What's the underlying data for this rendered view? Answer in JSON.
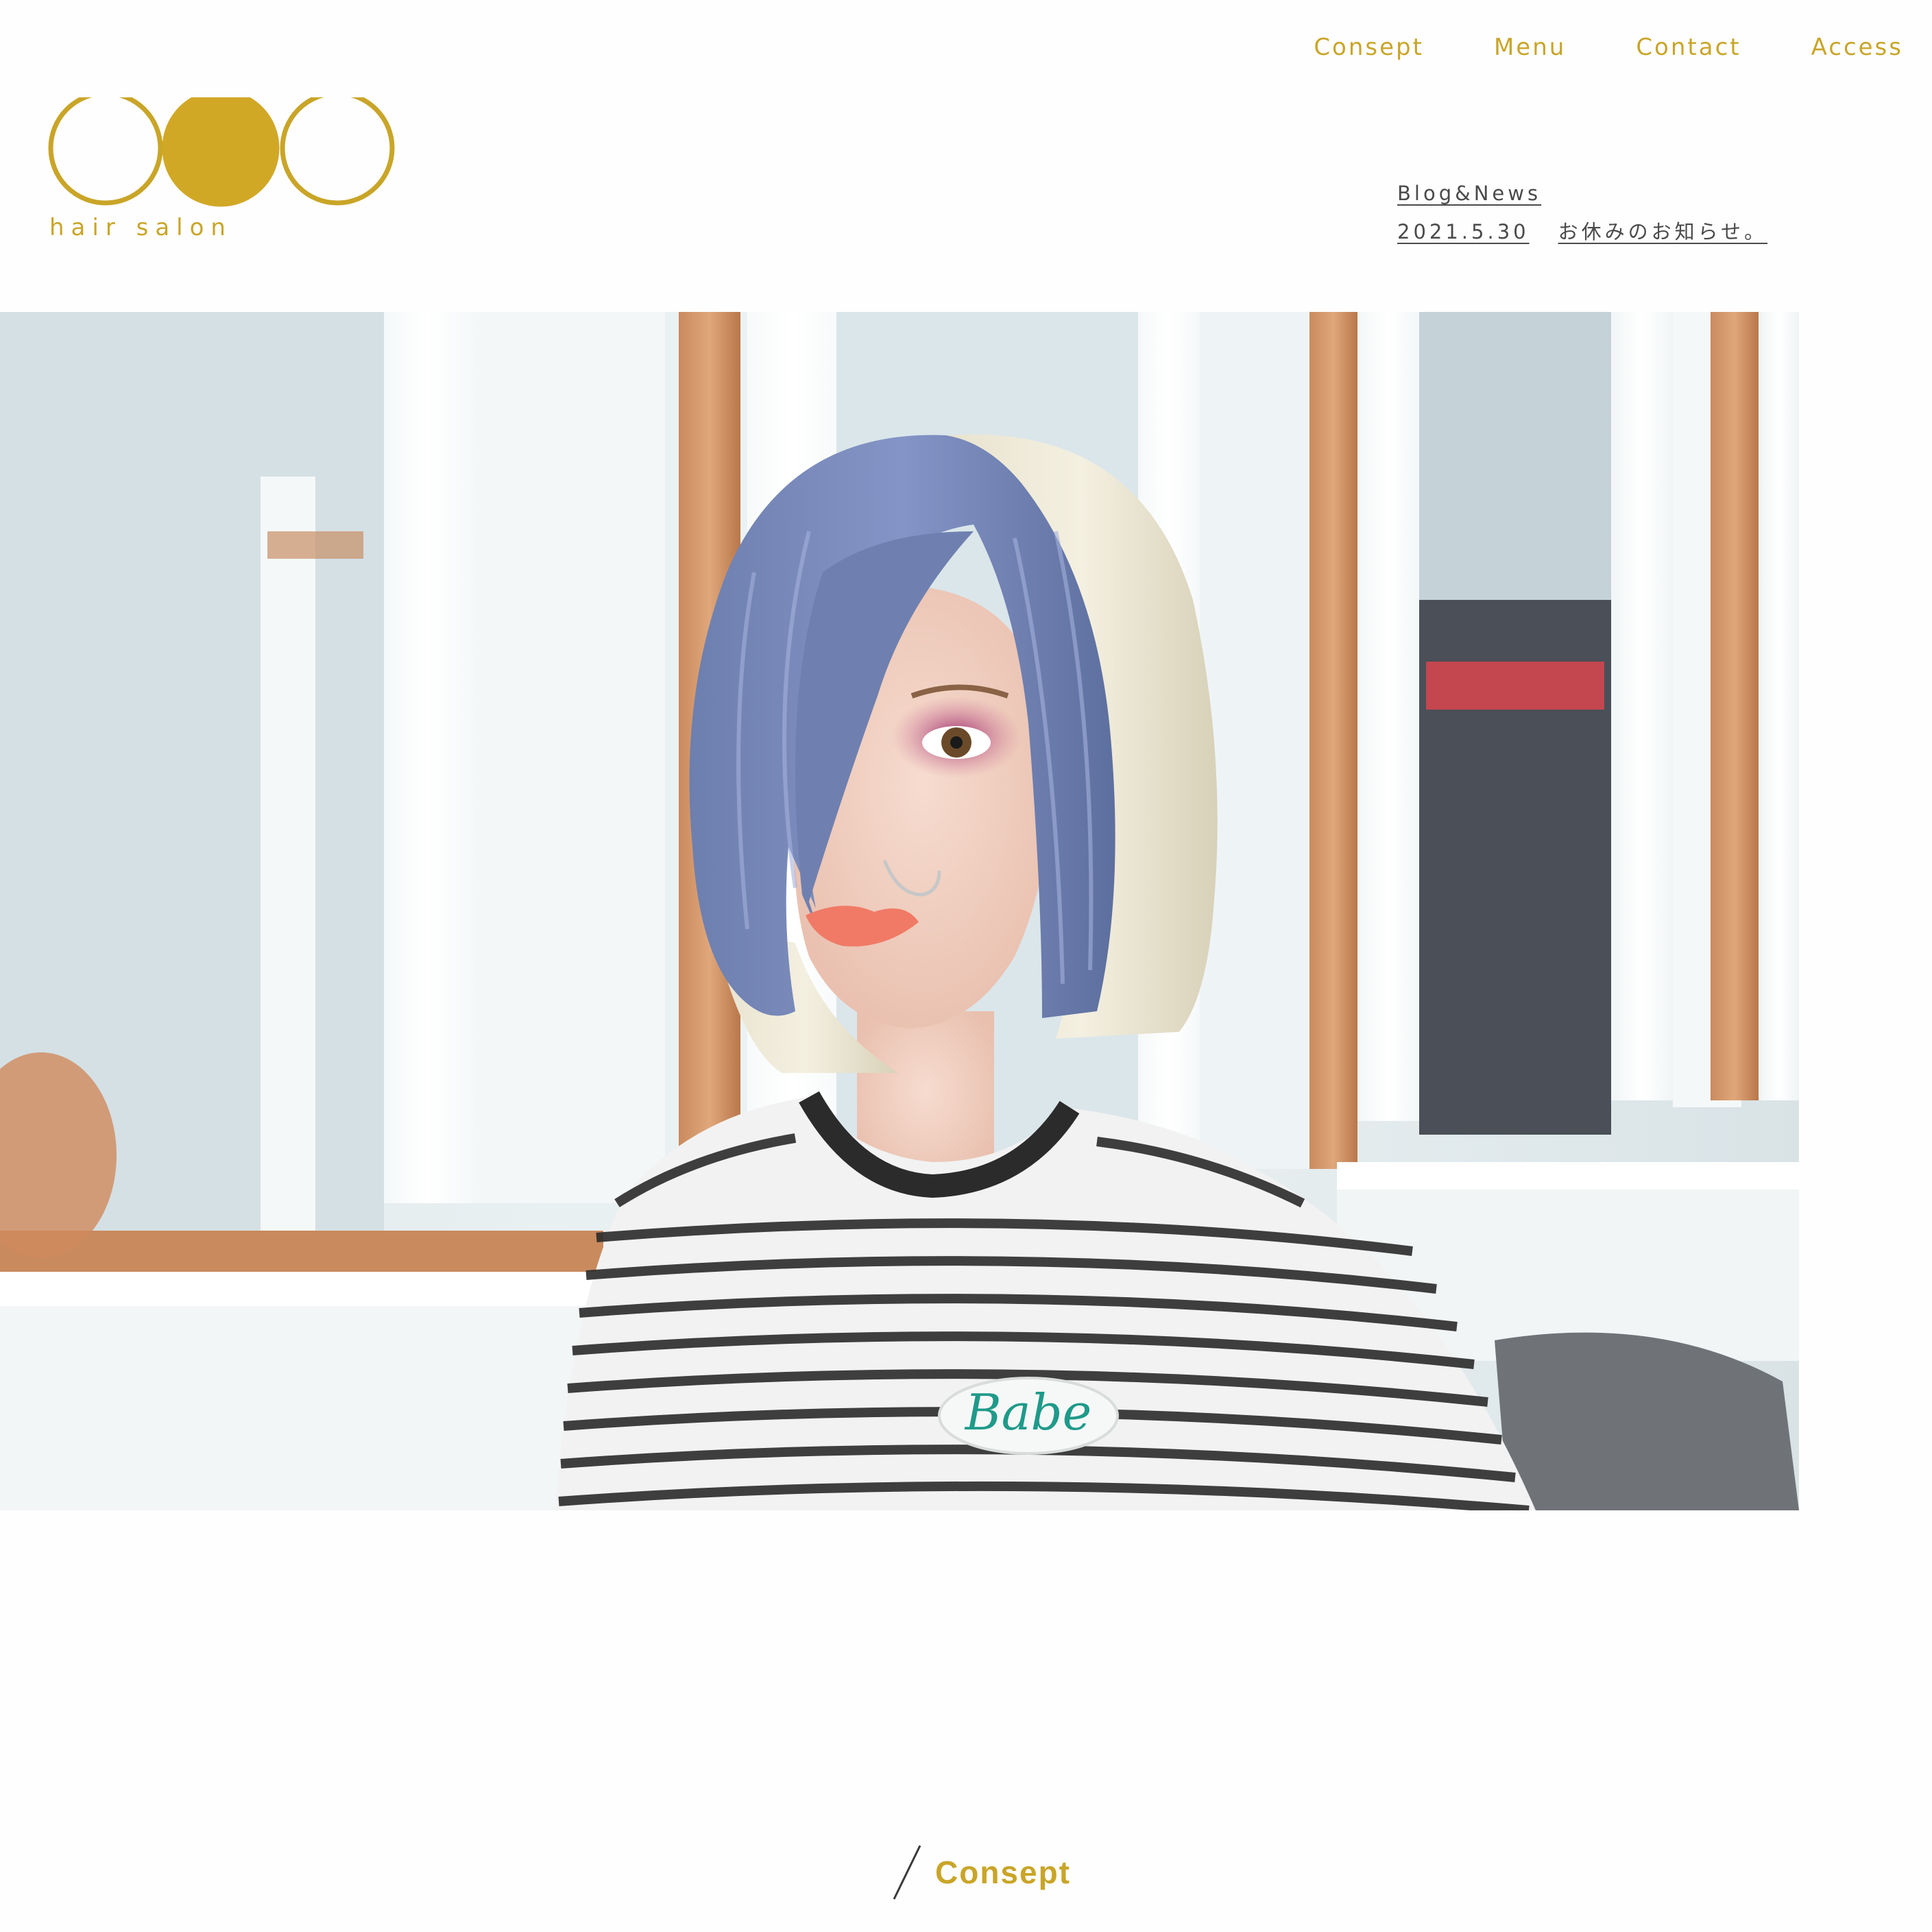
{
  "nav": {
    "items": [
      {
        "label": "Consept"
      },
      {
        "label": "Menu"
      },
      {
        "label": "Contact"
      },
      {
        "label": "Access"
      }
    ]
  },
  "logo": {
    "text": "hair salon",
    "brand_color": "#c9a528"
  },
  "news": {
    "title": "Blog&News",
    "items": [
      {
        "date": "2021.5.30",
        "text": "お休みのお知らせ。"
      }
    ]
  },
  "hero": {
    "shirt_patch_text": "Babe"
  },
  "section": {
    "heading": "Consept"
  },
  "colors": {
    "accent": "#c9a528",
    "text": "#4a4a4a",
    "background": "#fefefe"
  }
}
